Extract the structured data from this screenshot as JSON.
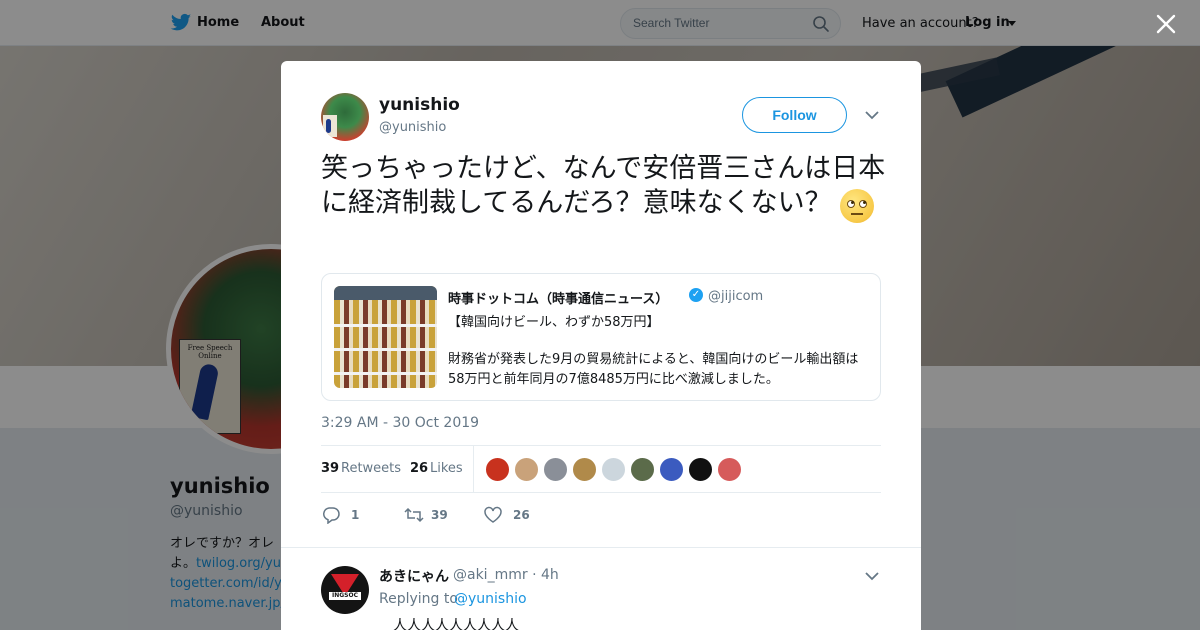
{
  "nav": {
    "home_label": "Home",
    "about_label": "About",
    "search_placeholder": "Search Twitter",
    "have_account_label": "Have an account?",
    "login_label": "Log in"
  },
  "background_profile": {
    "name": "yunishio",
    "handle": "@yunishio",
    "bio_line1": "オレですか？オレ",
    "bio_line2_prefix": "よ。",
    "bio_link1": "twilog.org/yun",
    "bio_link2": "togetter.com/id/yu",
    "bio_link3": "matome.naver.jp/",
    "avatar_sign_text": "Free Speech Online"
  },
  "tweet": {
    "author_name": "yunishio",
    "author_handle": "@yunishio",
    "follow_label": "Follow",
    "text": "笑っちゃったけど、なんで安倍晋三さんは日本に経済制裁してるんだろ？意味なくない？",
    "timestamp": "3:29 AM - 30 Oct 2019",
    "retweets_count": "39",
    "retweets_label": "Retweets",
    "likes_count": "26",
    "likes_label": "Likes",
    "likers_colors": [
      "#c8321e",
      "#c9a27a",
      "#8a8f98",
      "#b08a4a",
      "#ccd6dd",
      "#5b6b4a",
      "#3b5bbf",
      "#111111",
      "#d65b5b"
    ],
    "actions": {
      "reply_count": "1",
      "retweet_count": "39",
      "like_count": "26"
    }
  },
  "quoted_tweet": {
    "author_name": "時事ドットコム（時事通信ニュース）",
    "author_handle": "@jijicom",
    "verified_icon": "verified-badge-icon",
    "line1": "【韓国向けビール、わずか58万円】",
    "line2": "財務省が発表した9月の貿易統計によると、韓国向けのビール輸出額は58万円と前年同月の7億8485万円に比べ激減しました。"
  },
  "reply": {
    "author_name": "あきにゃん",
    "author_handle": "@aki_mmr",
    "time": "· 4h",
    "replying_to_label": "Replying to",
    "replying_to_user": "@yunishio",
    "text": "＿人人人人人人人人人＿",
    "avatar_text": "INGSOC"
  },
  "colors": {
    "accent": "#1b95e0",
    "verified": "#1da1f2",
    "muted": "#657786",
    "text": "#14171a"
  }
}
